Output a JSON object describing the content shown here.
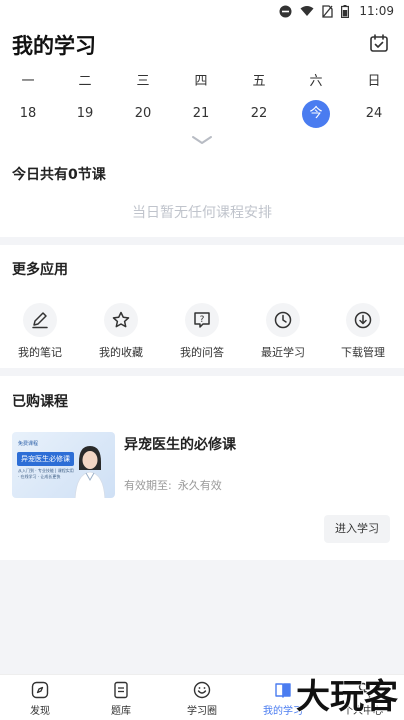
{
  "status_bar": {
    "time": "11:09",
    "icons": [
      "do-not-disturb-icon",
      "wifi-icon",
      "no-sim-icon",
      "battery-icon"
    ]
  },
  "header": {
    "title": "我的学习",
    "calendar_icon": "calendar-check-icon"
  },
  "week": {
    "days": [
      {
        "label": "一",
        "date": "18",
        "active": false
      },
      {
        "label": "二",
        "date": "19",
        "active": false
      },
      {
        "label": "三",
        "date": "20",
        "active": false
      },
      {
        "label": "四",
        "date": "21",
        "active": false
      },
      {
        "label": "五",
        "date": "22",
        "active": false
      },
      {
        "label": "六",
        "date": "今",
        "active": true
      },
      {
        "label": "日",
        "date": "24",
        "active": false
      }
    ],
    "expand_icon": "chevron-down-icon"
  },
  "today": {
    "title": "今日共有0节课",
    "empty_text": "当日暂无任何课程安排"
  },
  "apps": {
    "title": "更多应用",
    "items": [
      {
        "label": "我的笔记",
        "icon": "note-edit-icon"
      },
      {
        "label": "我的收藏",
        "icon": "star-icon"
      },
      {
        "label": "我的问答",
        "icon": "question-bubble-icon"
      },
      {
        "label": "最近学习",
        "icon": "clock-icon"
      },
      {
        "label": "下载管理",
        "icon": "download-icon"
      }
    ]
  },
  "purchased": {
    "title": "已购课程",
    "course": {
      "thumb_tag": "免费课程",
      "thumb_banner": "异宠医生必修课",
      "thumb_sub": "从入门到 · 专业技能 | 课程实用 · 在线学习 · 让成长更快",
      "title": "异宠医生的必修课",
      "validity_label": "有效期至:",
      "validity_value": "永久有效"
    },
    "enter_button": "进入学习"
  },
  "tabs": [
    {
      "label": "发现",
      "icon": "compass-icon",
      "active": false
    },
    {
      "label": "题库",
      "icon": "document-icon",
      "active": false
    },
    {
      "label": "学习圈",
      "icon": "smile-icon",
      "active": false
    },
    {
      "label": "我的学习",
      "icon": "book-icon",
      "active": true
    },
    {
      "label": "个人中心",
      "icon": "user-icon",
      "active": false
    }
  ],
  "watermark": {
    "text": "大玩客"
  },
  "colors": {
    "accent": "#4a7cf0",
    "muted": "#c0c4cc",
    "band": "#f3f4f7"
  }
}
